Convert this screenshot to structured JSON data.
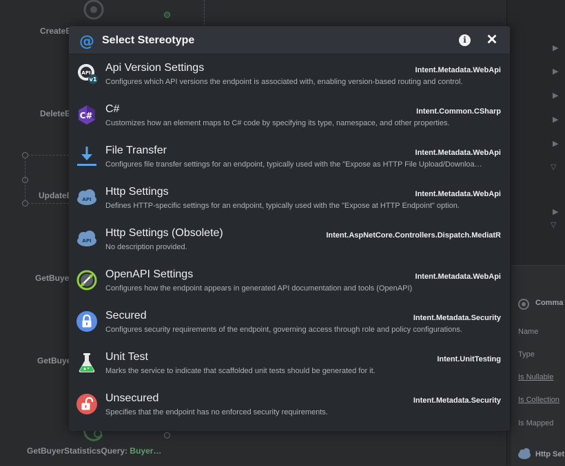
{
  "background": {
    "canvas_labels": [
      "CreateB",
      "DeleteE",
      "UpdateE",
      "GetBuye",
      "GetBuye"
    ],
    "bottom_label": "GetBuyerStatisticsQuery:",
    "bottom_label_type": "Buyer…",
    "panel": {
      "section_title": "Comma",
      "properties": [
        "Name",
        "Type",
        "Is Nullable",
        "Is Collection",
        "Is Mapped"
      ],
      "stereotype_section": "Http Set"
    }
  },
  "modal": {
    "title": "Select Stereotype",
    "info_icon": "info-icon",
    "close_icon": "close-icon",
    "items": [
      {
        "name": "Api Version Settings",
        "module": "Intent.Metadata.WebApi",
        "description": "Configures which API versions the endpoint is associated with, enabling version-based routing and control.",
        "icon": "api-version-icon",
        "icon_badge": "v1"
      },
      {
        "name": "C#",
        "module": "Intent.Common.CSharp",
        "description": "Customizes how an element maps to C# code by specifying its type, namespace, and other properties.",
        "icon": "csharp-icon",
        "icon_badge": "C#"
      },
      {
        "name": "File Transfer",
        "module": "Intent.Metadata.WebApi",
        "description": "Configures file transfer settings for an endpoint, typically used with the \"Expose as HTTP File Upload/Downloa…",
        "icon": "download-icon"
      },
      {
        "name": "Http Settings",
        "module": "Intent.Metadata.WebApi",
        "description": "Defines HTTP-specific settings for an endpoint, typically used with the \"Expose at HTTP Endpoint\" option.",
        "icon": "api-cloud-icon",
        "icon_badge": "API"
      },
      {
        "name": "Http Settings (Obsolete)",
        "module": "Intent.AspNetCore.Controllers.Dispatch.MediatR",
        "description": "No description provided.",
        "icon": "api-cloud-obsolete-icon",
        "icon_badge": "API"
      },
      {
        "name": "OpenAPI Settings",
        "module": "Intent.Metadata.WebApi",
        "description": "Configures how the endpoint appears in generated API documentation and tools (OpenAPI)",
        "icon": "openapi-icon"
      },
      {
        "name": "Secured",
        "module": "Intent.Metadata.Security",
        "description": "Configures security requirements of the endpoint, governing access through role and policy configurations.",
        "icon": "lock-icon"
      },
      {
        "name": "Unit Test",
        "module": "Intent.UnitTesting",
        "description": "Marks the service to indicate that scaffolded unit tests should be generated for it.",
        "icon": "flask-icon"
      },
      {
        "name": "Unsecured",
        "module": "Intent.Metadata.Security",
        "description": "Specifies that the endpoint has no enforced security requirements.",
        "icon": "unlock-icon"
      }
    ]
  },
  "colors": {
    "modal_bg": "#272b30",
    "header_bg": "#31353b",
    "logo_blue": "#3b8fd9",
    "secured_blue": "#5d8ee6",
    "unsecured_red": "#e45a57",
    "flask_green": "#3fbf5a",
    "csharp_purple": "#6a3fb5"
  }
}
